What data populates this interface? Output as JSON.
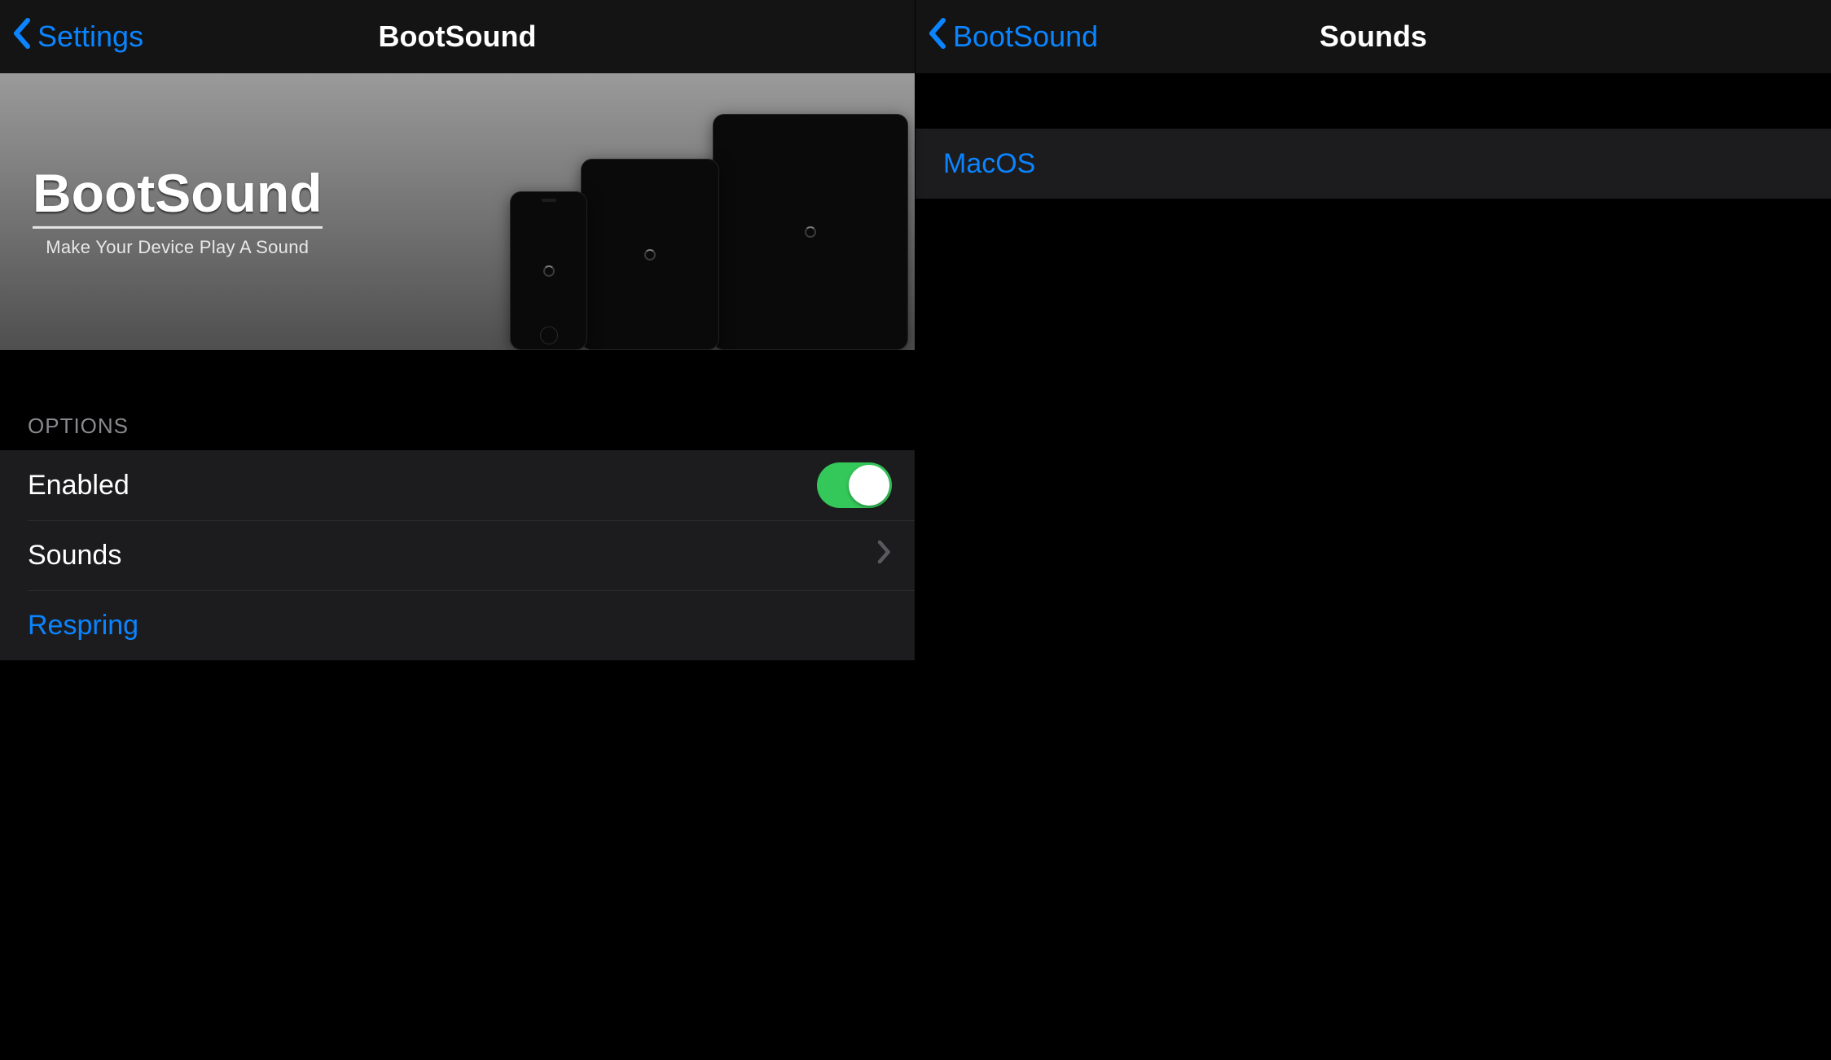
{
  "left": {
    "nav": {
      "back_label": "Settings",
      "title": "BootSound"
    },
    "hero": {
      "title": "BootSound",
      "subtitle": "Make Your Device Play A Sound"
    },
    "section_header": "OPTIONS",
    "rows": {
      "enabled_label": "Enabled",
      "enabled_value": true,
      "sounds_label": "Sounds",
      "respring_label": "Respring"
    }
  },
  "right": {
    "nav": {
      "back_label": "BootSound",
      "title": "Sounds"
    },
    "rows": {
      "macos_label": "MacOS"
    }
  },
  "colors": {
    "accent": "#0a84ff",
    "switch_on": "#34c759"
  }
}
